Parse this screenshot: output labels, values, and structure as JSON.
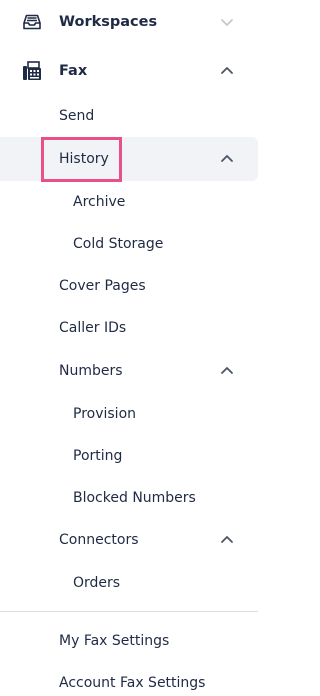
{
  "nav": {
    "workspaces": {
      "label": "Workspaces",
      "icon": "inbox-tray-icon",
      "expanded": false
    },
    "fax": {
      "label": "Fax",
      "icon": "fax-machine-icon",
      "expanded": true
    },
    "send": {
      "label": "Send"
    },
    "history": {
      "label": "History",
      "expanded": true,
      "selected": true
    },
    "archive": {
      "label": "Archive"
    },
    "cold_storage": {
      "label": "Cold Storage"
    },
    "cover_pages": {
      "label": "Cover Pages"
    },
    "caller_ids": {
      "label": "Caller IDs"
    },
    "numbers": {
      "label": "Numbers",
      "expanded": true
    },
    "provision": {
      "label": "Provision"
    },
    "porting": {
      "label": "Porting"
    },
    "blocked_numbers": {
      "label": "Blocked Numbers"
    },
    "connectors": {
      "label": "Connectors",
      "expanded": true
    },
    "orders": {
      "label": "Orders"
    },
    "my_fax_settings": {
      "label": "My Fax Settings"
    },
    "account_fax_settings": {
      "label": "Account Fax Settings"
    }
  },
  "colors": {
    "text": "#1f2a44",
    "chevron": "#6b7280",
    "chevron_muted": "#c4c8cf",
    "selected_bg": "#f1f3f6",
    "highlight": "#e8508a"
  }
}
